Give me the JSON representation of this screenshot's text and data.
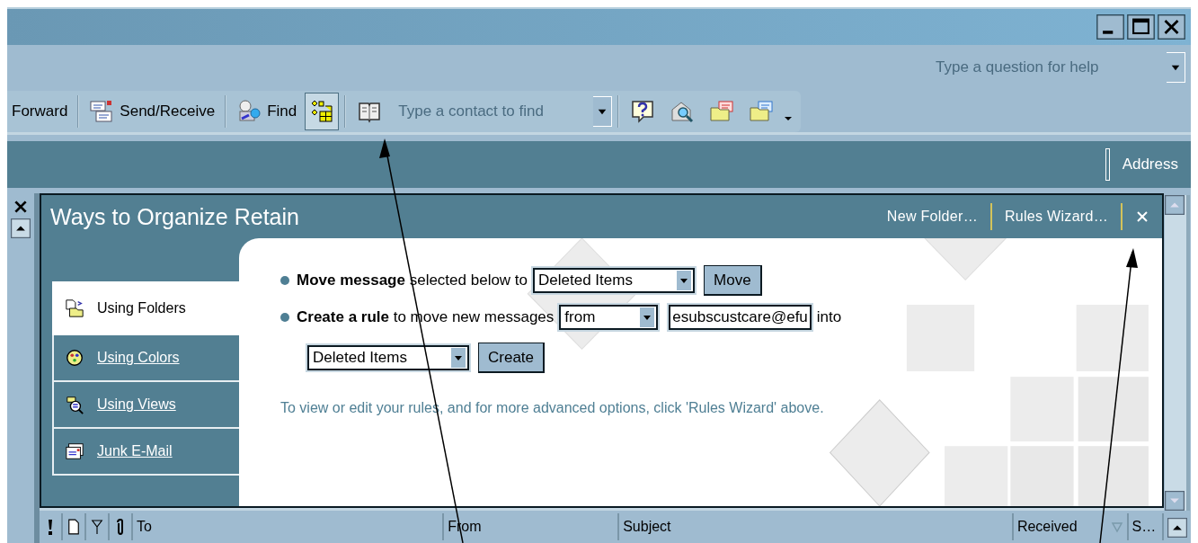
{
  "help": {
    "placeholder": "Type a question for help"
  },
  "toolbar": [
    {
      "kind": "text",
      "label": "Forward"
    },
    {
      "kind": "sep"
    },
    {
      "kind": "icon-text",
      "label": "Send/Receive"
    },
    {
      "kind": "sep"
    },
    {
      "kind": "icon-text",
      "label": "Find"
    },
    {
      "kind": "toggle",
      "pressed": true
    },
    {
      "kind": "sep"
    },
    {
      "kind": "icon"
    },
    {
      "kind": "field",
      "placeholder": "Type a contact to find"
    },
    {
      "kind": "sep"
    },
    {
      "kind": "icon"
    },
    {
      "kind": "icon"
    },
    {
      "kind": "icon"
    },
    {
      "kind": "icon"
    },
    {
      "kind": "more"
    }
  ],
  "bar": {
    "address_label": "Address"
  },
  "pane": {
    "title": "Ways to Organize Retain",
    "links": [
      "New Folder…",
      "Rules Wizard…"
    ],
    "tabs": [
      {
        "label": "Using Folders",
        "selected": true
      },
      {
        "label": "Using Colors",
        "selected": false
      },
      {
        "label": "Using Views",
        "selected": false
      },
      {
        "label": "Junk E-Mail",
        "selected": false
      }
    ],
    "move": {
      "bold": "Move message",
      "text": "selected below to",
      "folder": "Deleted Items",
      "button": "Move"
    },
    "rule": {
      "bold": "Create a rule",
      "text": "to move new messages",
      "condition": "from",
      "address": "esubscustcare@efu",
      "into": "into",
      "folder": "Deleted Items",
      "button": "Create"
    },
    "hint": "To view or edit your rules, and for more advanced options, click 'Rules Wizard' above."
  },
  "columns": [
    {
      "kind": "importance"
    },
    {
      "kind": "type"
    },
    {
      "kind": "flag"
    },
    {
      "kind": "attachment"
    },
    {
      "kind": "text",
      "label": "To",
      "sorted": false
    },
    {
      "kind": "text",
      "label": "From",
      "sorted": false
    },
    {
      "kind": "text",
      "label": "Subject",
      "sorted": false
    },
    {
      "kind": "text",
      "label": "Received",
      "sorted": true
    },
    {
      "kind": "text",
      "label": "S…",
      "sorted": false
    }
  ]
}
